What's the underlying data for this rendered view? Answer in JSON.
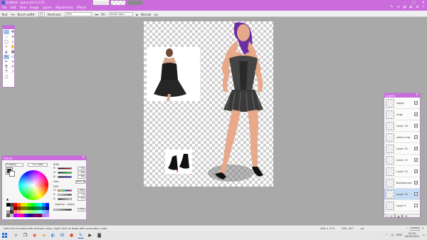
{
  "window": {
    "title": "Untitled - paint.net 4.2.15",
    "controls": [
      "–",
      "□",
      "✕"
    ]
  },
  "menu": {
    "items": [
      "File",
      "Edit",
      "View",
      "Image",
      "Layers",
      "Adjustments",
      "Effects"
    ]
  },
  "toolbar": {
    "tool_label": "Tool:",
    "brush_width_label": "Brush width:",
    "brush_width_value": "15",
    "hardness_label": "Hardness:",
    "hardness_value": "75%",
    "fill_label": "Fill:",
    "fill_value": "Solid Color",
    "blend_value": "Normal"
  },
  "colors_panel": {
    "title": "Colors",
    "mode": "Primary",
    "less_button": "<< Less",
    "rgb_label": "RGB",
    "r_label": "R:",
    "r_value": "43",
    "g_label": "G:",
    "g_value": "44",
    "b_label": "B:",
    "b_value": "43",
    "hex_label": "Hex:",
    "hex_value": "2B2C2B",
    "hsv_label": "HSV",
    "h_label": "H:",
    "h_value": "300",
    "s_label": "S:",
    "s_value": "2",
    "v_label": "V:",
    "v_value": "17",
    "opacity_label": "Opacity - Alpha",
    "opacity_value": "255",
    "palette": [
      "#000000",
      "#404040",
      "#ff0000",
      "#ff6a00",
      "#ffd800",
      "#b6ff00",
      "#4cff00",
      "#00ff21",
      "#00ff90",
      "#00ffff",
      "#0094ff",
      "#0026ff",
      "#ffffff",
      "#808080",
      "#7f0000",
      "#7f3300",
      "#7f6a00",
      "#5b7f00",
      "#267f00",
      "#007f0e",
      "#007f46",
      "#007f7f",
      "#004a7f",
      "#00137f",
      "#a0a0a0",
      "#303030",
      "#ff7f7f",
      "#ffb27f",
      "#ffe97f",
      "#daff7f",
      "#a5ff7f",
      "#7fff8e",
      "#7fffc5",
      "#7fffff",
      "#7fc9ff",
      "#7f92ff",
      "#606060",
      "#c0c0c0",
      "#b200ff",
      "#ff00dc",
      "#ff006e",
      "#4800ff",
      "#21007f",
      "#57007f",
      "#7f006e",
      "#7f0037",
      "#a17fff",
      "#d67fff"
    ]
  },
  "layers_panel": {
    "title": "Layers",
    "layers": [
      {
        "name": "zipper",
        "visible": true,
        "selected": false
      },
      {
        "name": "ringz",
        "visible": true,
        "selected": false
      },
      {
        "name": "Layer 16",
        "visible": true,
        "selected": false
      },
      {
        "name": "colour mig",
        "visible": true,
        "selected": false
      },
      {
        "name": "Layer 14",
        "visible": true,
        "selected": false
      },
      {
        "name": "Layer 15",
        "visible": true,
        "selected": false
      },
      {
        "name": "Layer 13",
        "visible": true,
        "selected": false
      },
      {
        "name": "Background",
        "visible": true,
        "selected": false
      },
      {
        "name": "Layer 19",
        "visible": true,
        "selected": true
      },
      {
        "name": "Layer 9",
        "visible": false,
        "selected": false
      }
    ]
  },
  "statusbar": {
    "message": "Left click to draw with primary color, right click to draw with secondary color.",
    "size": "440 × 473",
    "cursor": "505, 847",
    "unit": "px",
    "zoom": "100%"
  },
  "taskbar": {
    "time": "00:15",
    "date": "04/02/2021",
    "lang": "NOB"
  },
  "colors": {
    "accent": "#cb6cdc",
    "workspace": "#a9a9a9"
  }
}
